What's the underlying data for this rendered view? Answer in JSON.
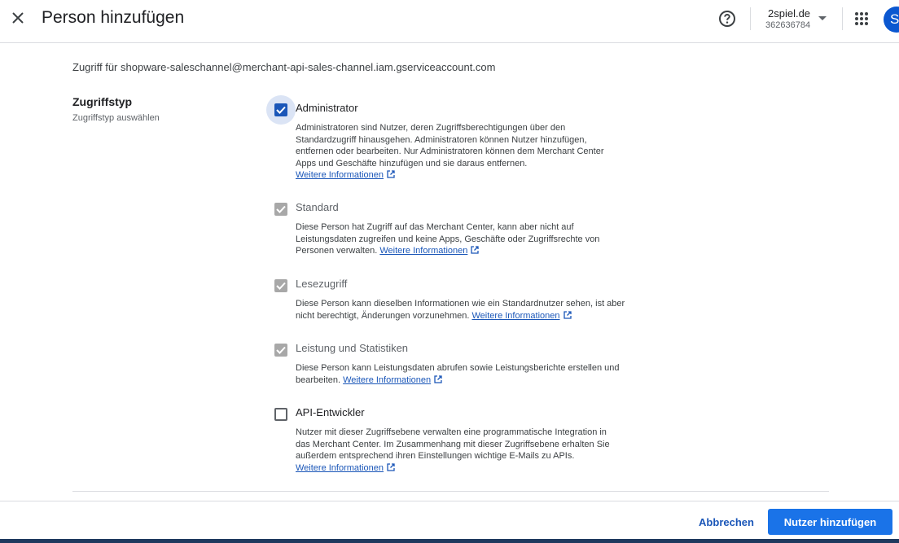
{
  "header": {
    "title": "Person hinzufügen",
    "account_name": "2spiel.de",
    "account_id": "362636784",
    "avatar_letter": "S",
    "icons": {
      "close": "close-icon",
      "help": "help-circle-icon",
      "caret": "caret-down-icon",
      "apps": "apps-grid-icon"
    }
  },
  "main": {
    "access_text": "Zugriff für shopware-saleschannel@merchant-api-sales-channel.iam.gserviceaccount.com",
    "section_title": "Zugriffstyp",
    "section_subtitle": "Zugriffstyp auswählen",
    "link_text": "Weitere Informationen",
    "options": [
      {
        "label": "Administrator",
        "state": "checked",
        "desc_lines": [
          "Administratoren sind Nutzer, deren Zugriffsberechtigungen über den",
          "Standardzugriff hinausgehen. Administratoren können Nutzer hinzufügen,",
          "entfernen oder bearbeiten. Nur Administratoren können dem Merchant Center",
          "Apps und Geschäfte hinzufügen und sie daraus entfernen."
        ]
      },
      {
        "label": "Standard",
        "state": "checked-disabled",
        "desc_lines": [
          "Diese Person hat Zugriff auf das Merchant Center, kann aber nicht auf",
          "Leistungsdaten zugreifen und keine Apps, Geschäfte oder Zugriffsrechte von",
          "Personen verwalten."
        ]
      },
      {
        "label": "Lesezugriff",
        "state": "checked-disabled",
        "desc_lines": [
          "Diese Person kann dieselben Informationen wie ein Standardnutzer sehen, ist aber",
          "nicht berechtigt, Änderungen vorzunehmen."
        ]
      },
      {
        "label": "Leistung und Statistiken",
        "state": "checked-disabled",
        "desc_lines": [
          "Diese Person kann Leistungsdaten abrufen sowie Leistungsberichte erstellen und",
          "bearbeiten."
        ]
      },
      {
        "label": "API-Entwickler",
        "state": "unchecked",
        "desc_lines": [
          "Nutzer mit dieser Zugriffsebene verwalten eine programmatische Integration in",
          "das Merchant Center. Im Zusammenhang mit dieser Zugriffsebene erhalten Sie",
          "außerdem entsprechend ihren Einstellungen wichtige E-Mails zu APIs."
        ]
      }
    ]
  },
  "footer": {
    "cancel_label": "Abbrechen",
    "submit_label": "Nutzer hinzufügen"
  },
  "colors": {
    "accent": "#1a73e8",
    "link": "#1a56b8",
    "disabled_check": "#a8a8a8"
  }
}
